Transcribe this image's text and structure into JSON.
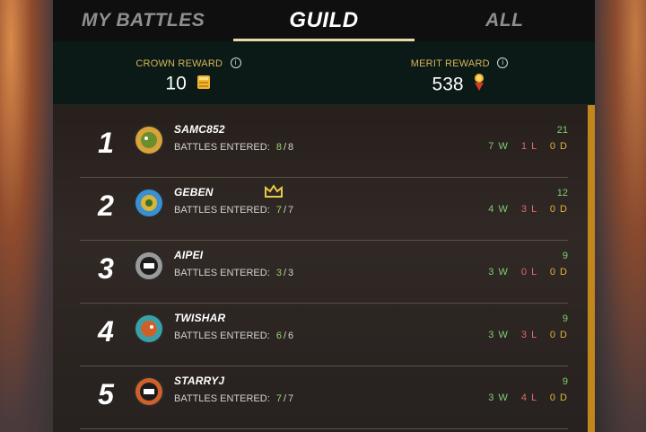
{
  "tabs": [
    {
      "label": "MY BATTLES",
      "active": false
    },
    {
      "label": "GUILD",
      "active": true
    },
    {
      "label": "ALL",
      "active": false
    }
  ],
  "rewards": {
    "crown": {
      "label": "CROWN REWARD",
      "value": "10",
      "icon": "crown-reward-icon"
    },
    "merit": {
      "label": "MERIT REWARD",
      "value": "538",
      "icon": "merit-reward-icon"
    }
  },
  "rows": [
    {
      "rank": "1",
      "name": "SAMC852",
      "entered_label": "BATTLES ENTERED:",
      "entered": "8",
      "total": "8",
      "score": "21",
      "w": "7 W",
      "l": "1 L",
      "d": "0 D",
      "crown": false,
      "avatar_color": "#d9a23a"
    },
    {
      "rank": "2",
      "name": "GEBEN",
      "entered_label": "BATTLES ENTERED:",
      "entered": "7",
      "total": "7",
      "score": "12",
      "w": "4 W",
      "l": "3 L",
      "d": "0 D",
      "crown": true,
      "avatar_color": "#3a8fd0"
    },
    {
      "rank": "3",
      "name": "AIPEI",
      "entered_label": "BATTLES ENTERED:",
      "entered": "3",
      "total": "3",
      "score": "9",
      "w": "3 W",
      "l": "0 L",
      "d": "0 D",
      "crown": false,
      "avatar_color": "#9a9a9a"
    },
    {
      "rank": "4",
      "name": "TWISHAR",
      "entered_label": "BATTLES ENTERED:",
      "entered": "6",
      "total": "6",
      "score": "9",
      "w": "3 W",
      "l": "3 L",
      "d": "0 D",
      "crown": false,
      "avatar_color": "#3aa0a8"
    },
    {
      "rank": "5",
      "name": "STARRYJ",
      "entered_label": "BATTLES ENTERED:",
      "entered": "7",
      "total": "7",
      "score": "9",
      "w": "3 W",
      "l": "4 L",
      "d": "0 D",
      "crown": false,
      "avatar_color": "#d0602a"
    }
  ],
  "colors": {
    "accent": "#e9d9a8",
    "gold": "#d7b45c",
    "win": "#7fcf73",
    "loss": "#e06a6a",
    "draw": "#e1b43a",
    "scroll": "#c2861f"
  }
}
